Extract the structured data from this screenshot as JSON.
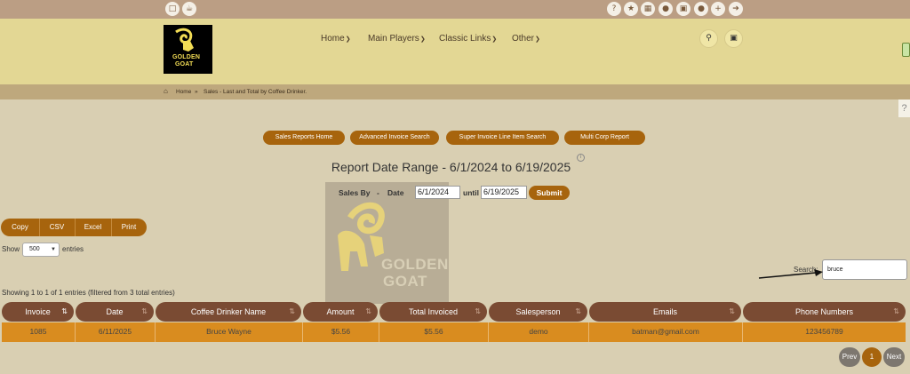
{
  "topbar": {
    "left_icons": [
      "chat-icon",
      "coffee-cup-icon"
    ],
    "right_icons": [
      "help-icon",
      "star-icon",
      "building-icon",
      "group-icon",
      "calendar-icon",
      "user-icon",
      "add-user-icon",
      "logout-icon"
    ]
  },
  "logo": {
    "line1": "GOLDEN",
    "line2": "GOAT"
  },
  "nav": [
    {
      "label": "Home"
    },
    {
      "label": "Main Players"
    },
    {
      "label": "Classic Links"
    },
    {
      "label": "Other"
    }
  ],
  "header_buttons": {
    "search_icon": "search-icon",
    "cart_icon": "cart-icon"
  },
  "breadcrumb": {
    "home": "Home",
    "sep": "»",
    "current": "Sales - Last and Total by Coffee Drinker."
  },
  "report_buttons": [
    "Sales Reports Home",
    "Advanced Invoice Search",
    "Super Invoice Line Item Search",
    "Multi Corp Report"
  ],
  "title": "Report Date Range - 6/1/2024 to 6/19/2025",
  "watermark": {
    "line1": "GOLDEN",
    "line2": "GOAT"
  },
  "filter": {
    "sales_by": "Sales By",
    "dash": "-",
    "date_label": "Date",
    "from": "6/1/2024",
    "until_label": "until",
    "to": "6/19/2025",
    "submit": "Submit"
  },
  "export_buttons": [
    "Copy",
    "CSV",
    "Excel",
    "Print"
  ],
  "length": {
    "show": "Show",
    "value": "500",
    "entries": "entries"
  },
  "search": {
    "label": "Search:",
    "value": "bruce"
  },
  "info": "Showing 1 to 1 of 1 entries (filtered from 3 total entries)",
  "table": {
    "columns": [
      "Invoice",
      "Date",
      "Coffee Drinker Name",
      "Amount",
      "Total Invoiced",
      "Salesperson",
      "Emails",
      "Phone Numbers"
    ],
    "rows": [
      [
        "1085",
        "6/11/2025",
        "Bruce Wayne",
        "$5.56",
        "$5.56",
        "demo",
        "batman@gmail.com",
        "123456789"
      ]
    ]
  },
  "pagination": {
    "prev": "Prev",
    "page": "1",
    "next": "Next"
  },
  "colors": {
    "accent": "#a7640d",
    "header_bg": "#e3d794",
    "topbar_bg": "#bb9e84",
    "page_bg": "#d9cfb2",
    "table_header": "#7a4b33",
    "row_bg": "#d98c1f"
  }
}
